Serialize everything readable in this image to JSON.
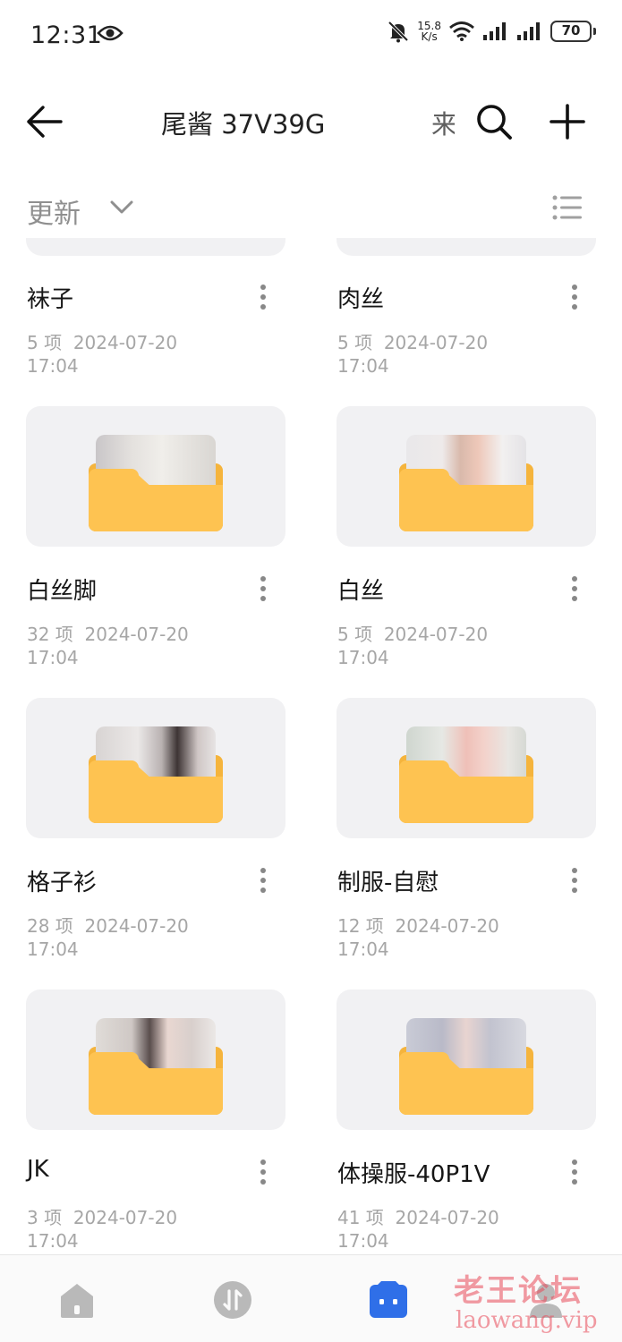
{
  "status_bar": {
    "time": "12:31",
    "net_speed_value": "15.8",
    "net_speed_unit": "K/s",
    "battery": "70",
    "icons": [
      "eye-icon",
      "mute-bell-icon",
      "wifi-icon",
      "signal-icon",
      "signal-icon",
      "battery-icon"
    ]
  },
  "header": {
    "title": "尾酱 37V39G",
    "title_overflow": "来",
    "back_icon": "arrow-left-icon",
    "search_icon": "search-icon",
    "add_icon": "plus-icon"
  },
  "sort": {
    "label": "更新",
    "chevron_icon": "chevron-down-icon",
    "view_icon": "list-view-icon"
  },
  "folders": [
    {
      "name": "袜子",
      "count": "5 项",
      "date": "2024-07-20",
      "time": "17:04"
    },
    {
      "name": "肉丝",
      "count": "5 项",
      "date": "2024-07-20",
      "time": "17:04"
    },
    {
      "name": "白丝脚",
      "count": "32 项",
      "date": "2024-07-20",
      "time": "17:04"
    },
    {
      "name": "白丝",
      "count": "5 项",
      "date": "2024-07-20",
      "time": "17:04"
    },
    {
      "name": "格子衫",
      "count": "28 项",
      "date": "2024-07-20",
      "time": "17:04"
    },
    {
      "name": "制服-自慰",
      "count": "12 项",
      "date": "2024-07-20",
      "time": "17:04"
    },
    {
      "name": "JK",
      "count": "3 项",
      "date": "2024-07-20",
      "time": "17:04"
    },
    {
      "name": "体操服-40P1V",
      "count": "41 项",
      "date": "2024-07-20",
      "time": "17:04"
    }
  ],
  "bottom_nav": {
    "items": [
      "home-icon",
      "transfer-icon",
      "files-icon",
      "profile-icon"
    ],
    "active": "files-icon"
  },
  "watermark": {
    "text_cn": "老王论坛",
    "text_en": "laowang.vip"
  },
  "colors": {
    "folder": "#fec351",
    "folder_back": "#f5b43c",
    "card_bg": "#f1f1f3",
    "active_nav": "#2f6fe8",
    "meta_text": "#a6a6a6"
  }
}
